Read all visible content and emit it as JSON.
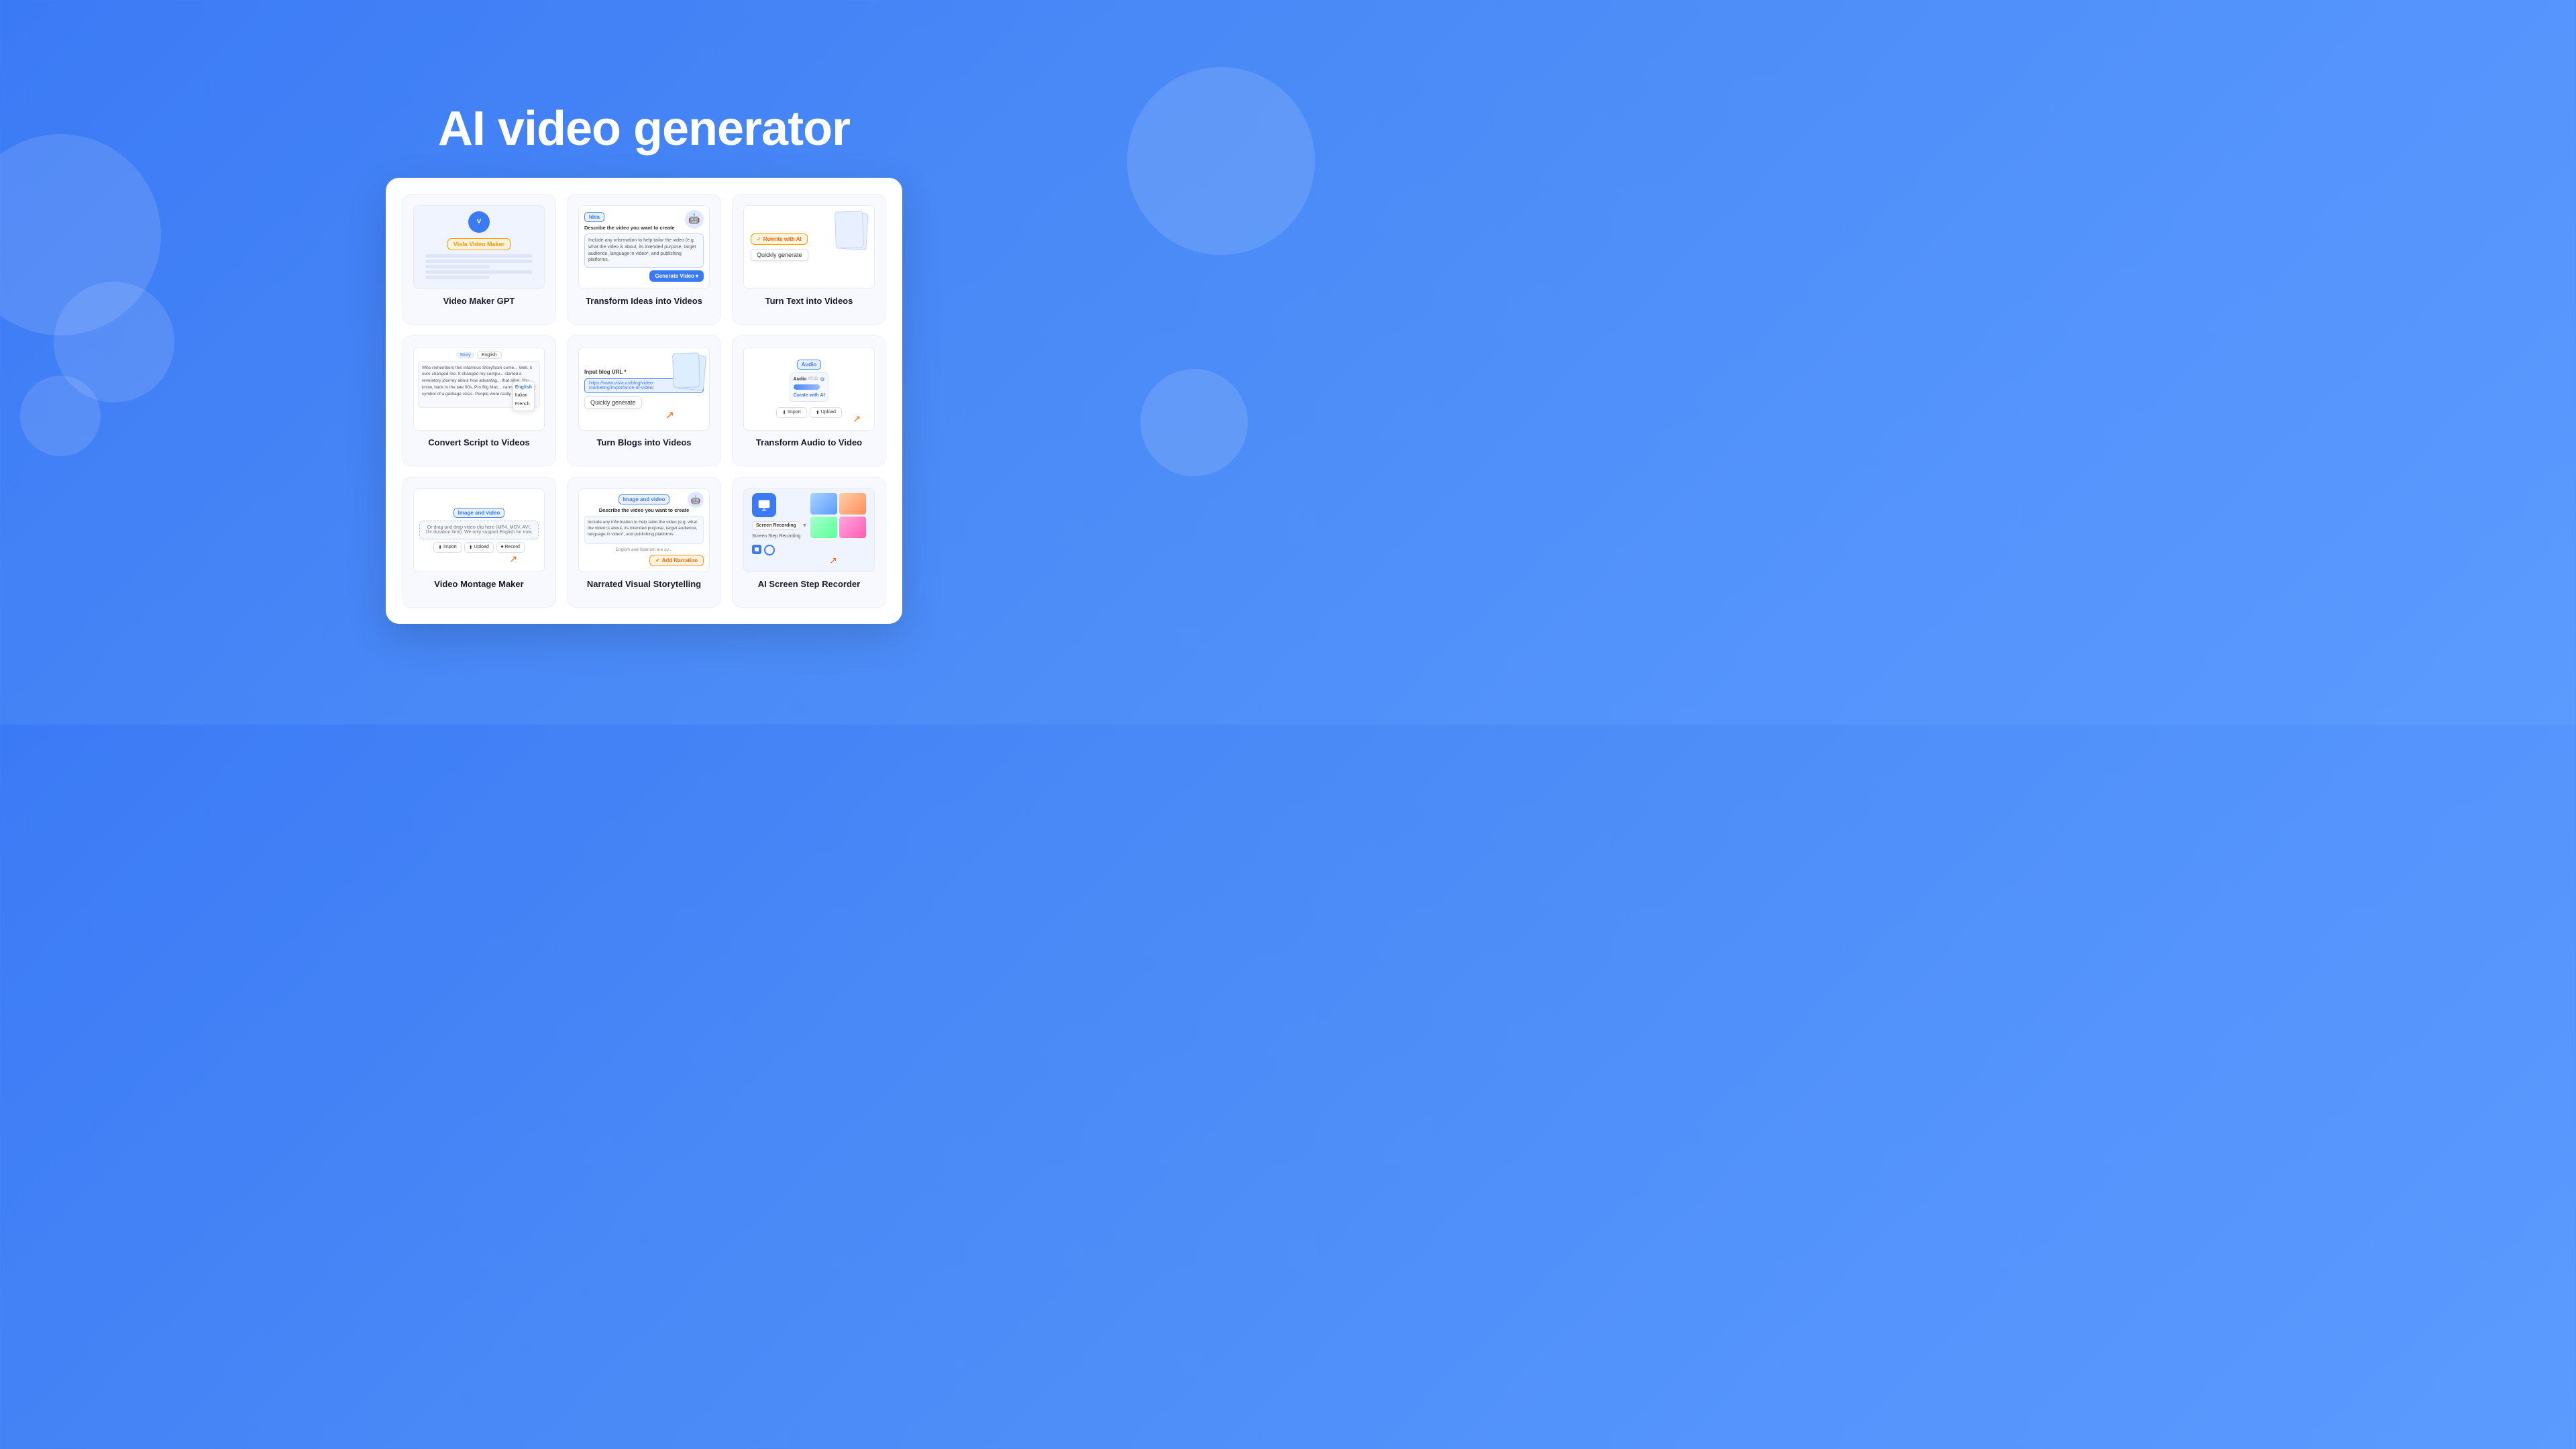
{
  "page": {
    "title": "AI video generator",
    "background": "#4a8af7"
  },
  "cards": [
    {
      "id": "video-maker-gpt",
      "label": "Video Maker GPT",
      "preview_type": "gpt"
    },
    {
      "id": "transform-ideas",
      "label": "Transform Ideas into Videos",
      "preview_type": "ideas"
    },
    {
      "id": "turn-text",
      "label": "Turn Text into Videos",
      "preview_type": "text"
    },
    {
      "id": "convert-script",
      "label": "Convert Script to Videos",
      "preview_type": "script"
    },
    {
      "id": "turn-blogs",
      "label": "Turn Blogs into Videos",
      "preview_type": "blog"
    },
    {
      "id": "transform-audio",
      "label": "Transform Audio to Video",
      "preview_type": "audio"
    },
    {
      "id": "video-montage",
      "label": "Video Montage Maker",
      "preview_type": "montage"
    },
    {
      "id": "narrated-visual",
      "label": "Narrated Visual Storytelling",
      "preview_type": "narrated"
    },
    {
      "id": "ai-screen",
      "label": "AI Screen Step Recorder",
      "preview_type": "screen"
    }
  ],
  "ui": {
    "visla_label": "Visla Video Maker",
    "idea_tag": "Idea",
    "idea_placeholder": "Describe the video you want to create",
    "idea_body": "Include any information to help tailor the video (e.g. what the video is about, its intended purpose, target audience, language in video*, and publishing platforms.",
    "generate_btn": "Generate Video",
    "rewrite_btn": "Rewrite with AI",
    "quickly_label": "Quickly generate",
    "story_tag": "Story",
    "english_label": "English",
    "lang_options": [
      "English",
      "Italian",
      "French"
    ],
    "blog_url_label": "Input blog URL *",
    "blog_url_value": "https://www.visla.us/blog/video-marketing/importance-of-video/",
    "quickly_blog": "Quickly generate",
    "audio_tag": "Audio",
    "audio_label": "Audio",
    "audio_time": "00:11",
    "curate_label": "Curate with AI",
    "import_label": "Import",
    "upload_label": "Upload",
    "image_video_tag": "Image and video",
    "drop_text": "Or drag and drop video clip here (MP4, MOV, AVI, 1hr duration limit). We only support English for now.",
    "import_btn": "Import",
    "upload_btn": "Upload",
    "record_btn": "Record",
    "narrated_tag": "Image and video",
    "narrated_placeholder": "Describe the video you want to create",
    "narrated_body": "Include any information to help tailor the video (e.g. what the video is about, its intended purpose, target audience, language in video*, and publishing platforms.",
    "narrated_note": "English and Spanish are su...",
    "add_narration_btn": "Add Narration",
    "screen_recording_label": "Screen Recording",
    "screen_stop_label": "Screen Step Recording"
  }
}
